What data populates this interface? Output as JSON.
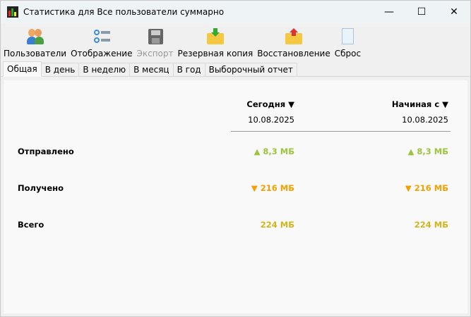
{
  "window": {
    "title": "Статистика для Все пользователи суммарно",
    "minimize": "—",
    "maximize": "☐",
    "close": "✕"
  },
  "toolbar": [
    {
      "label": "Пользователи",
      "icon": "users-icon"
    },
    {
      "label": "Отображение",
      "icon": "display-options-icon"
    },
    {
      "label": "Экспорт",
      "icon": "floppy-disk-icon",
      "disabled": true
    },
    {
      "label": "Резервная копия",
      "icon": "folder-download-icon"
    },
    {
      "label": "Восстановление",
      "icon": "folder-upload-icon"
    },
    {
      "label": "Сброс",
      "icon": "blank-document-icon"
    }
  ],
  "tabs": [
    "Общая",
    "В день",
    "В неделю",
    "В месяц",
    "В год",
    "Выборочный отчет"
  ],
  "columns": [
    {
      "header": "Сегодня ▼",
      "date": "10.08.2025"
    },
    {
      "header": "Начиная с ▼",
      "date": "10.08.2025"
    }
  ],
  "rows": [
    {
      "label": "Отправлено",
      "values": [
        "▲ 8,3 МБ",
        "▲ 8,3 МБ"
      ],
      "color": "#9bc53d"
    },
    {
      "label": "Получено",
      "values": [
        "▼ 216 МБ",
        "▼ 216 МБ"
      ],
      "color": "#f5a000"
    },
    {
      "label": "Всего",
      "values": [
        "224 МБ",
        "224 МБ"
      ],
      "color": "#d4b41c"
    }
  ]
}
